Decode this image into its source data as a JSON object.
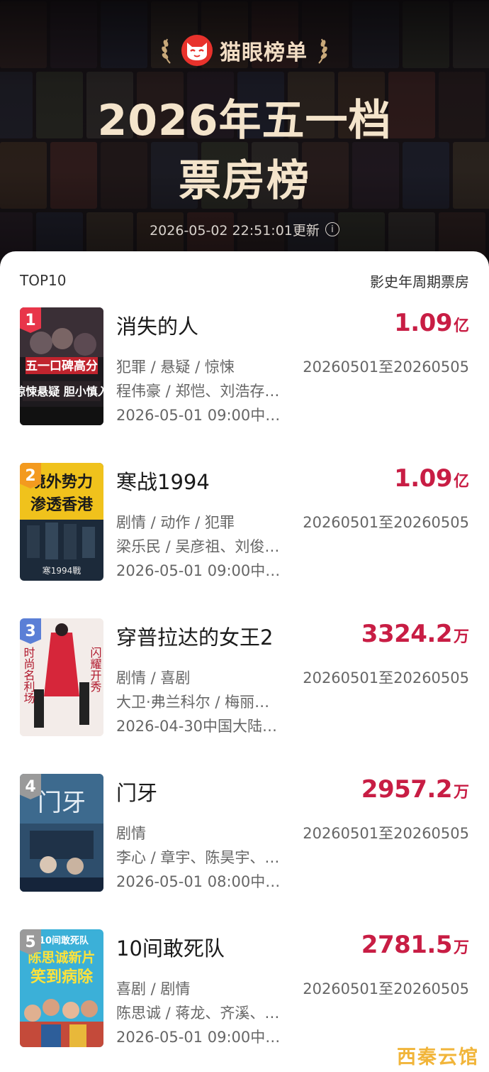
{
  "header": {
    "brand_name": "猫眼榜单",
    "title_line1": "2026年五一档",
    "title_line2": "票房榜",
    "updated_text": "2026-05-02 22:51:01更新"
  },
  "list": {
    "left_label": "TOP10",
    "right_label": "影史年周期票房"
  },
  "movies": [
    {
      "rank": "1",
      "title": "消失的人",
      "box_number": "1.09",
      "box_unit": "亿",
      "genre": "犯罪 / 悬疑 / 惊悚",
      "cast": "程伟豪 / 郑恺、刘浩存…",
      "release": "2026-05-01 09:00中…",
      "period": "20260501至20260505",
      "badge_color": "#e8364a",
      "poster_text": [
        "五一口碑高分",
        "惊悚悬疑 胆小慎入"
      ]
    },
    {
      "rank": "2",
      "title": "寒战1994",
      "box_number": "1.09",
      "box_unit": "亿",
      "genre": "剧情 / 动作 / 犯罪",
      "cast": "梁乐民 / 吴彦祖、刘俊…",
      "release": "2026-05-01 09:00中…",
      "period": "20260501至20260505",
      "badge_color": "#f39a1f",
      "poster_text": [
        "境外势力",
        "渗透香港",
        "寒1994戰"
      ]
    },
    {
      "rank": "3",
      "title": "穿普拉达的女王2",
      "box_number": "3324.2",
      "box_unit": "万",
      "genre": "剧情 / 喜剧",
      "cast": "大卫·弗兰科尔 / 梅丽…",
      "release": "2026-04-30中国大陆…",
      "period": "20260501至20260505",
      "badge_color": "#5b7fd6",
      "poster_text": [
        "时尚名利场",
        "闪耀开秀"
      ]
    },
    {
      "rank": "4",
      "title": "门牙",
      "box_number": "2957.2",
      "box_unit": "万",
      "genre": "剧情",
      "cast": "李心 / 章宇、陈昊宇、…",
      "release": "2026-05-01 08:00中…",
      "period": "20260501至20260505",
      "badge_color": "#9a9a9a",
      "poster_text": [
        "门牙"
      ]
    },
    {
      "rank": "5",
      "title": "10间敢死队",
      "box_number": "2781.5",
      "box_unit": "万",
      "genre": "喜剧 / 剧情",
      "cast": "陈思诚 / 蒋龙、齐溪、…",
      "release": "2026-05-01 09:00中…",
      "period": "20260501至20260505",
      "badge_color": "#9a9a9a",
      "poster_text": [
        "10间敢死队",
        "陈思诚新片",
        "笑到病除"
      ]
    }
  ],
  "watermark": "西秦云馆",
  "icons": {
    "brand_logo": "cat-logo-icon",
    "laurel": "laurel-icon",
    "info": "info-icon"
  }
}
